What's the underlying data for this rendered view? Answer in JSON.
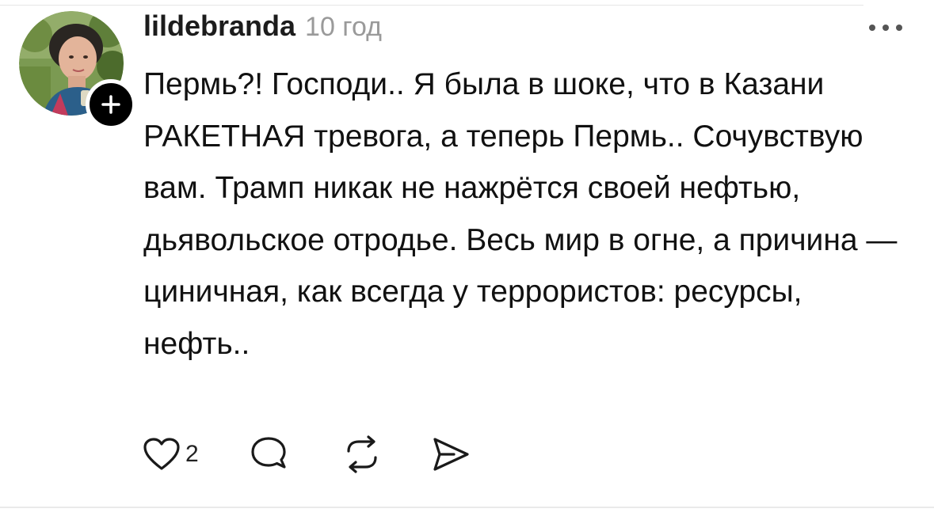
{
  "comment": {
    "username": "lildebranda",
    "timestamp": "10 год",
    "text": "Пермь?! Господи.. Я была в шоке, что в Казани РАКЕТНАЯ тревога, а теперь Пермь.. Сочувствую вам. Трамп никак не нажрётся своей нефтью, дьявольское отродье. Весь мир в огне, а причина — циничная, как всегда у террористов: ресурсы, нефть..",
    "like_count": "2"
  },
  "icons": {
    "avatar": "avatar-photo",
    "follow": "plus-icon",
    "more": "more-dots-icon",
    "like": "heart-icon",
    "reply": "comment-bubble-icon",
    "repost": "repost-icon",
    "share": "send-icon"
  },
  "colors": {
    "text": "#111111",
    "muted": "#9a9a9a",
    "badge": "#000000"
  }
}
